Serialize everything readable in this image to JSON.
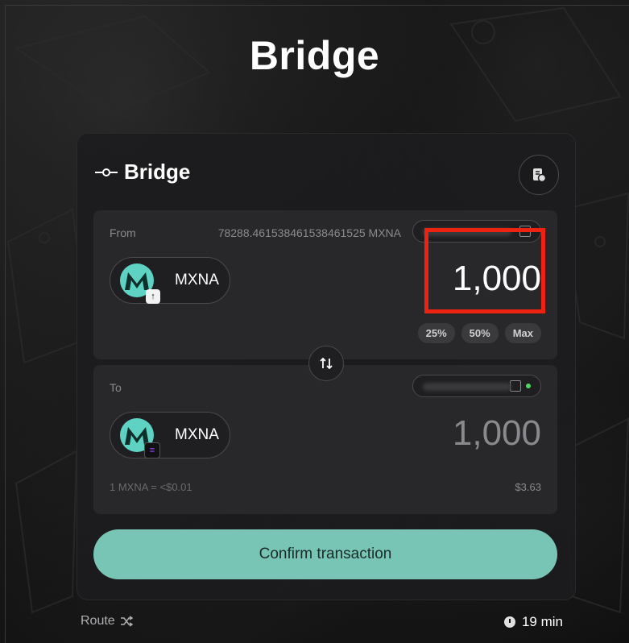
{
  "page": {
    "title": "Bridge"
  },
  "card": {
    "title": "Bridge",
    "icons": {
      "header": "bridge-icon",
      "history": "history-icon"
    }
  },
  "from": {
    "label": "From",
    "balance": "78288.461538461538461525 MXNA",
    "token": {
      "symbol": "MXNA",
      "chain_badge": "arrow-up-badge"
    },
    "amount": "1,000",
    "percent_buttons": [
      "25%",
      "50%",
      "Max"
    ]
  },
  "to": {
    "label": "To",
    "token": {
      "symbol": "MXNA",
      "chain_badge": "solana-badge"
    },
    "amount": "1,000",
    "rate": "1 MXNA = <$0.01",
    "usd_value": "$3.63"
  },
  "confirm_label": "Confirm transaction",
  "footer": {
    "route_label": "Route",
    "eta": "19 min"
  },
  "colors": {
    "accent": "#78c5b6",
    "token_logo": "#5fd3c3",
    "highlight": "#ee2211"
  }
}
